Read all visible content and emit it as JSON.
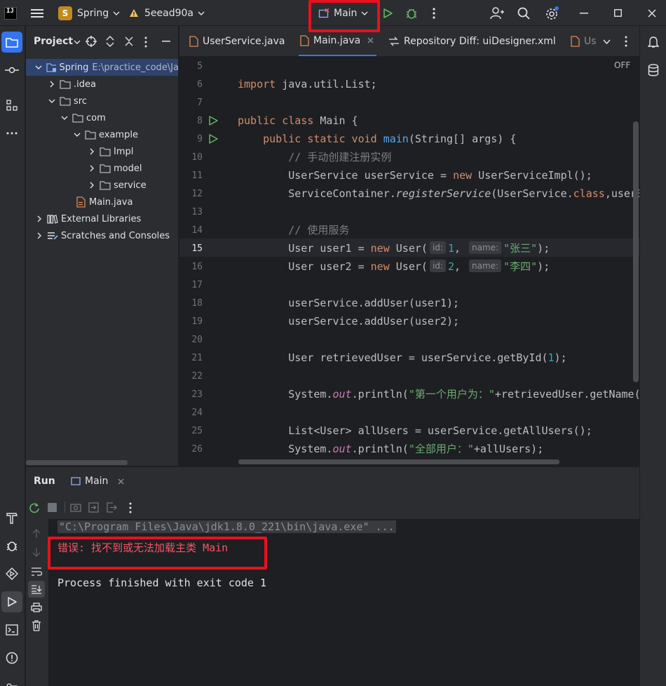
{
  "titlebar": {
    "logo": "IJ",
    "project_badge": "S",
    "project_name": "Spring",
    "vcs_branch": "5eead90a",
    "run_config": "Main",
    "icons": [
      "hamburger-menu-icon",
      "warning-icon",
      "run-icon",
      "debug-icon",
      "more-icon",
      "add-user-icon",
      "search-icon",
      "settings-icon",
      "minimize-icon",
      "maximize-icon",
      "close-icon"
    ]
  },
  "project_panel": {
    "title": "Project",
    "tree": [
      {
        "label": "Spring",
        "hint": "E:\\practice_code\\Ja",
        "icon": "module-folder-icon"
      },
      {
        "label": ".idea",
        "icon": "folder-icon"
      },
      {
        "label": "src",
        "icon": "folder-icon"
      },
      {
        "label": "com",
        "icon": "folder-icon"
      },
      {
        "label": "example",
        "icon": "folder-icon"
      },
      {
        "label": "Impl",
        "icon": "folder-icon"
      },
      {
        "label": "model",
        "icon": "folder-icon"
      },
      {
        "label": "service",
        "icon": "folder-icon"
      },
      {
        "label": "Main.java",
        "icon": "java-file-icon"
      },
      {
        "label": "External Libraries",
        "icon": "library-icon"
      },
      {
        "label": "Scratches and Consoles",
        "icon": "scratches-icon"
      }
    ]
  },
  "editor": {
    "tabs": [
      {
        "label": "UserService.java"
      },
      {
        "label": "Main.java"
      },
      {
        "label": "Repository Diff: uiDesigner.xml"
      },
      {
        "label": "Us"
      }
    ],
    "reader_mode": "OFF",
    "line_numbers": [
      "5",
      "6",
      "7",
      "8",
      "9",
      "10",
      "11",
      "12",
      "13",
      "14",
      "15",
      "16",
      "17",
      "18",
      "19",
      "20",
      "21",
      "22",
      "23",
      "24",
      "25",
      "26"
    ],
    "current_line": "15",
    "code": {
      "l6_kw": "import",
      "l6_rest": " java.util.List;",
      "l8_kw": "public class",
      "l8_rest": " Main {",
      "l9_kw": "public static void",
      "l9_fn": "main",
      "l9_rest": "(String[] args) {",
      "l10": "// 手动创建注册实例",
      "l11_a": "UserService userService = ",
      "l11_kw": "new",
      "l11_b": " UserServiceImpl();",
      "l12_a": "ServiceContainer.",
      "l12_m": "registerService",
      "l12_b": "(UserService.",
      "l12_kw": "class",
      "l12_c": ",userS",
      "l14": "// 使用服务",
      "l15_a": "User user1 = ",
      "l15_kw": "new",
      "l15_b": " User(",
      "l15_h1": "id:",
      "l15_n": "1",
      "l15_c": ",",
      "l15_h2": "name:",
      "l15_s": "\"张三\"",
      "l15_d": ");",
      "l16_a": "User user2 = ",
      "l16_kw": "new",
      "l16_b": " User(",
      "l16_h1": "id:",
      "l16_n": "2",
      "l16_c": ",",
      "l16_h2": "name:",
      "l16_s": "\"李四\"",
      "l16_d": ");",
      "l18": "userService.addUser(user1);",
      "l19": "userService.addUser(user2);",
      "l21_a": "User retrievedUser = userService.getById(",
      "l21_n": "1",
      "l21_b": ");",
      "l23_a": "System.",
      "l23_out": "out",
      "l23_b": ".println(",
      "l23_s": "\"第一个用户为：\"",
      "l23_c": "+retrievedUser.getName(",
      "l25": "List<User> allUsers = userService.getAllUsers();",
      "l26_a": "System.",
      "l26_out": "out",
      "l26_b": ".println(",
      "l26_s": "\"全部用户：\"",
      "l26_c": "+allUsers);"
    }
  },
  "run_panel": {
    "title": "Run",
    "tab": "Main",
    "console": {
      "command": "\"C:\\Program Files\\Java\\jdk1.8.0_221\\bin\\java.exe\" ...",
      "error": "错误: 找不到或无法加载主类 Main",
      "exit": "Process finished with exit code 1"
    }
  },
  "colors": {
    "accent": "#3574f0",
    "error": "#f75464",
    "highlight_box": "#e8101f",
    "run_green": "#5fb865"
  }
}
